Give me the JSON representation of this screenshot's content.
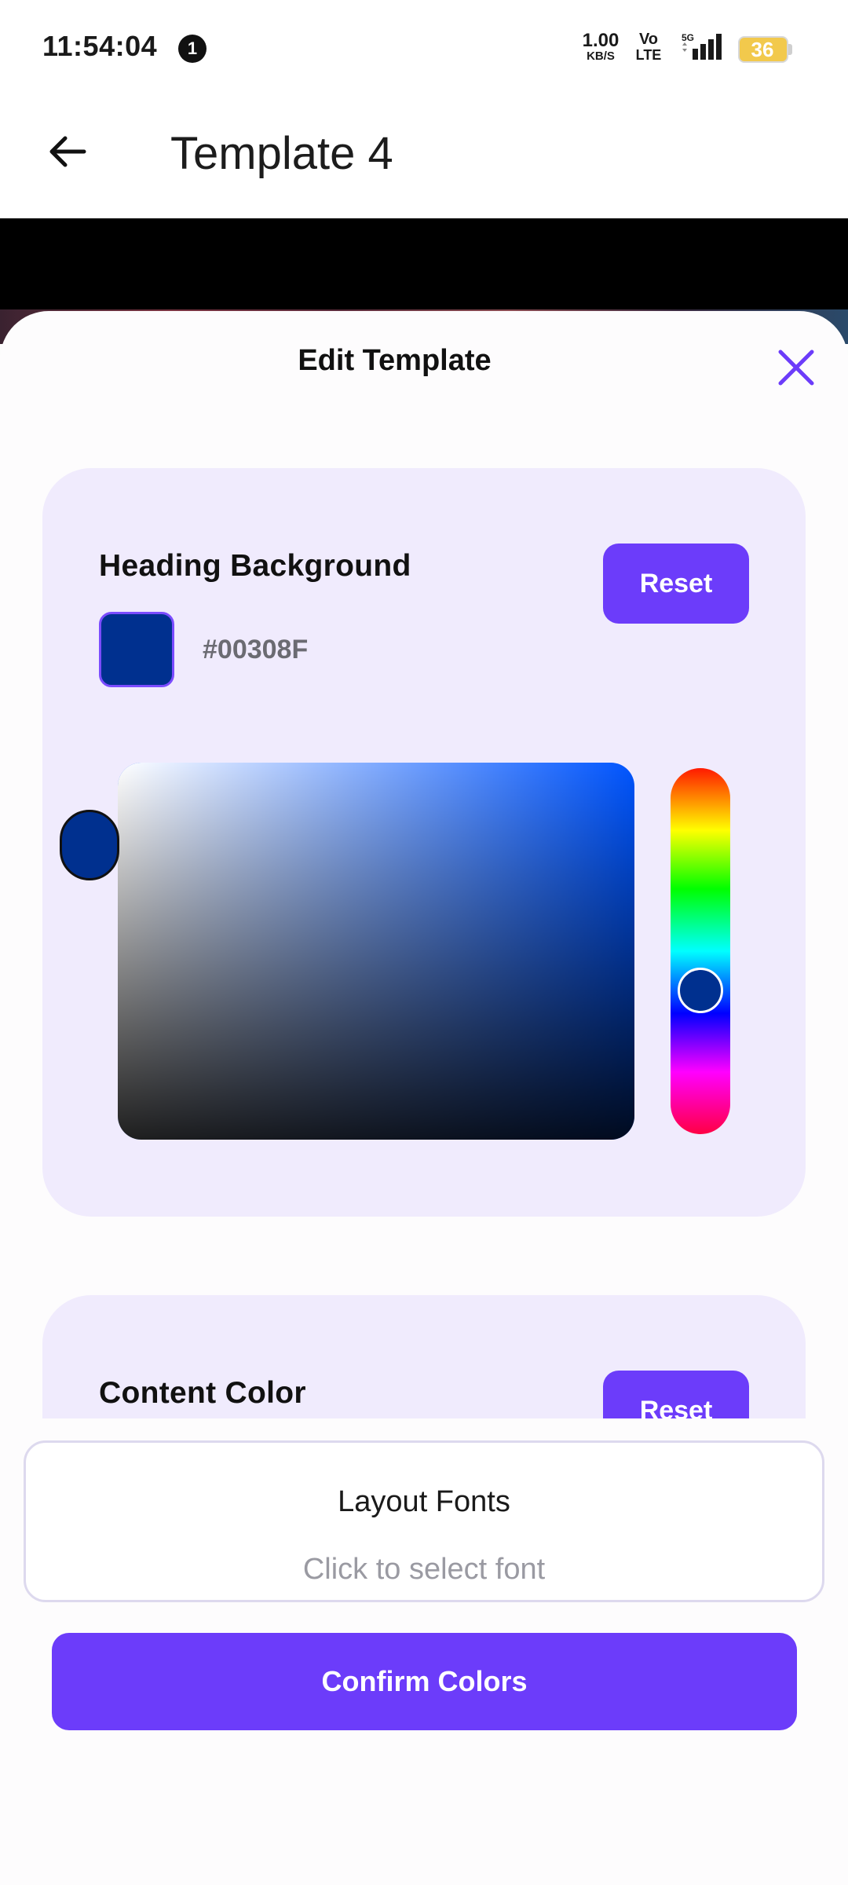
{
  "status_bar": {
    "time": "11:54:04",
    "notification_count": "1",
    "net_speed_value": "1.00",
    "net_speed_unit": "KB/S",
    "volte_top": "Vo",
    "volte_bottom": "LTE",
    "network_type": "5G",
    "battery_level": "36",
    "battery_color": "#f2c94c"
  },
  "app_bar": {
    "back_icon": "arrow-left-icon",
    "title": "Template 4"
  },
  "sheet": {
    "title": "Edit Template",
    "close_icon": "close-icon",
    "heading_background": {
      "title": "Heading Background",
      "reset_label": "Reset",
      "hex": "#00308F",
      "hue_color": "#0055ff"
    },
    "content_color": {
      "title": "Content Color",
      "reset_label": "Reset"
    },
    "layout_fonts": {
      "title": "Layout Fonts",
      "placeholder": "Click to select font"
    },
    "confirm_label": "Confirm Colors"
  },
  "colors": {
    "accent": "#6c3cfa",
    "card_bg": "#f0ebfd"
  }
}
